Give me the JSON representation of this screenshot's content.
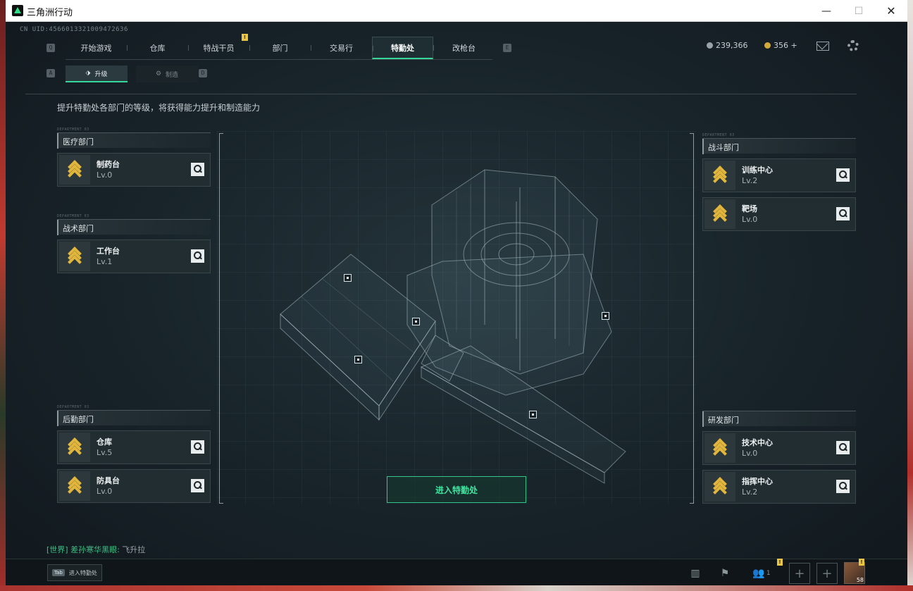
{
  "window": {
    "title": "三角洲行动",
    "minimize": "—",
    "maximize": "☐",
    "close": "✕"
  },
  "uid": "CN UID:4566013321009472636",
  "nav": {
    "key_left": "Q",
    "key_right": "E",
    "tabs": [
      "开始游戏",
      "仓库",
      "特战干员",
      "部门",
      "交易行",
      "特勤处",
      "改枪台"
    ],
    "active": "特勤处",
    "badge": "!"
  },
  "currency": {
    "silver": "239,366",
    "gold": "356 +"
  },
  "subtabs": {
    "key_left": "A",
    "key_right": "D",
    "upgrade": "升级",
    "craft": "制造"
  },
  "description": "提升特勤处各部门的等级，将获得能力提升和制造能力",
  "dept_tag": "DEPARTMENT 03",
  "left_departments": [
    {
      "header": "医疗部门",
      "cards": [
        {
          "name": "制药台",
          "level": "Lv.0"
        }
      ]
    },
    {
      "header": "战术部门",
      "cards": [
        {
          "name": "工作台",
          "level": "Lv.1"
        }
      ]
    },
    {
      "header": "后勤部门",
      "cards": [
        {
          "name": "仓库",
          "level": "Lv.5"
        },
        {
          "name": "防具台",
          "level": "Lv.0"
        }
      ]
    }
  ],
  "right_departments": [
    {
      "header": "战斗部门",
      "cards": [
        {
          "name": "训练中心",
          "level": "Lv.2"
        },
        {
          "name": "靶场",
          "level": "Lv.0"
        }
      ]
    },
    {
      "header": "研发部门",
      "cards": [
        {
          "name": "技术中心",
          "level": "Lv.0"
        },
        {
          "name": "指挥中心",
          "level": "Lv.2"
        }
      ]
    }
  ],
  "enter_button": "进入特勤处",
  "chat": {
    "channel": "[世界]",
    "user": "差孙寒华黑眼",
    "message": "飞升拉"
  },
  "tab_hint": {
    "key": "Tab",
    "label": "进入特勤处"
  },
  "bottom": {
    "friends_count": "1",
    "avatar_level": "58"
  },
  "colors": {
    "accent": "#35d89a",
    "gold_icon": "#e2b63c",
    "badge": "#e9c543"
  }
}
